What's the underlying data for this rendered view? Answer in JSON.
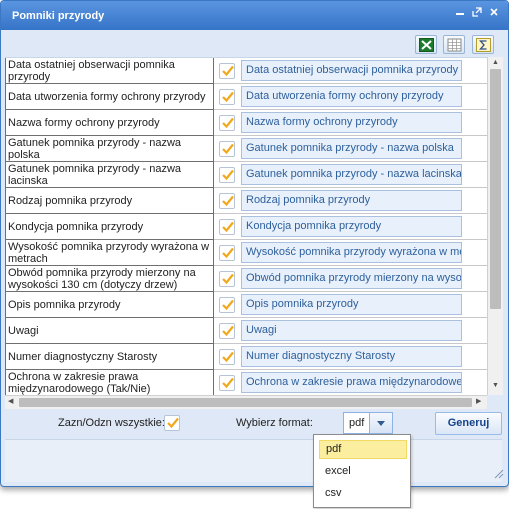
{
  "window": {
    "title": "Pomniki przyrody"
  },
  "toolbar": {
    "icons": [
      "excel-icon",
      "grid-icon",
      "sum-icon"
    ]
  },
  "rows": [
    {
      "label": "Data ostatniej obserwacji pomnika przyrody",
      "checked": true,
      "value": "Data ostatniej obserwacji pomnika przyrody"
    },
    {
      "label": "Data utworzenia formy ochrony przyrody",
      "checked": true,
      "value": "Data utworzenia formy ochrony przyrody"
    },
    {
      "label": "Nazwa formy ochrony przyrody",
      "checked": true,
      "value": "Nazwa formy ochrony przyrody"
    },
    {
      "label": "Gatunek pomnika przyrody - nazwa polska",
      "checked": true,
      "value": "Gatunek pomnika przyrody - nazwa polska"
    },
    {
      "label": "Gatunek pomnika przyrody - nazwa lacinska",
      "checked": true,
      "value": "Gatunek pomnika przyrody - nazwa lacinska"
    },
    {
      "label": "Rodzaj pomnika przyrody",
      "checked": true,
      "value": "Rodzaj pomnika przyrody"
    },
    {
      "label": "Kondycja pomnika przyrody",
      "checked": true,
      "value": "Kondycja pomnika przyrody"
    },
    {
      "label": "Wysokość pomnika przyrody wyrażona w metrach",
      "checked": true,
      "value": "Wysokość pomnika przyrody wyrażona w me"
    },
    {
      "label": "Obwód pomnika przyrody mierzony na wysokości 130 cm (dotyczy drzew)",
      "checked": true,
      "value": "Obwód pomnika przyrody mierzony na wysol"
    },
    {
      "label": "Opis pomnika przyrody",
      "checked": true,
      "value": "Opis pomnika przyrody"
    },
    {
      "label": "Uwagi",
      "checked": true,
      "value": "Uwagi"
    },
    {
      "label": "Numer diagnostyczny Starosty",
      "checked": true,
      "value": "Numer diagnostyczny Starosty"
    },
    {
      "label": "Ochrona w zakresie prawa międzynarodowego (Tak/Nie)",
      "checked": true,
      "value": "Ochrona w zakresie prawa międzynarodowe"
    }
  ],
  "footer": {
    "select_all_label": "Zazn/Odzn wszystkie:",
    "select_all_checked": true,
    "format_label": "Wybierz format:",
    "format_value": "pdf",
    "generate_label": "Generuj"
  },
  "format_options": [
    "pdf",
    "excel",
    "csv"
  ],
  "colors": {
    "title_bar": "#3674c8",
    "check": "#f0a81c",
    "input_text": "#2d5f9c",
    "highlight": "#fbee9e"
  }
}
